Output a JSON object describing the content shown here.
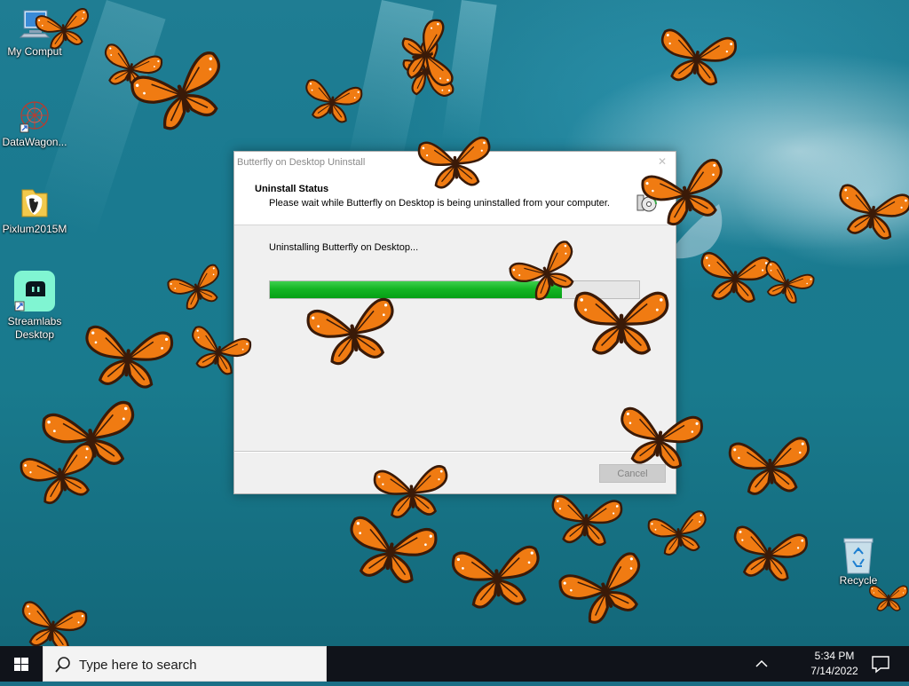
{
  "desktop": {
    "icons": [
      {
        "label": "My Comput",
        "icon": "computer-icon"
      },
      {
        "label": "DataWagon...",
        "icon": "datawagon-icon"
      },
      {
        "label": "Pixlum2015M",
        "icon": "folder-icon"
      },
      {
        "label": "Streamlabs Desktop",
        "icon": "streamlabs-icon"
      },
      {
        "label": "Recycle",
        "icon": "recycle-bin-icon"
      }
    ],
    "wallpaper_colors": {
      "water": "#1a7a90",
      "deep": "#13687a",
      "foam": "#ffffff"
    },
    "butterfly_colors": {
      "wing": "#f07b12",
      "vein": "#3a1a08",
      "spot": "#ffffff"
    }
  },
  "dialog": {
    "title": "Butterfly on Desktop Uninstall",
    "close_glyph": "✕",
    "header_title": "Uninstall Status",
    "header_subtitle": "Please wait while Butterfly on Desktop is being uninstalled from your computer.",
    "status_text": "Uninstalling Butterfly on Desktop...",
    "progress_fraction": 0.79,
    "cancel_label": "Cancel",
    "progress_color": "#14b524"
  },
  "taskbar": {
    "search_placeholder": "Type here to search",
    "time": "5:34 PM",
    "date": "7/14/2022",
    "background": "#10131a"
  }
}
